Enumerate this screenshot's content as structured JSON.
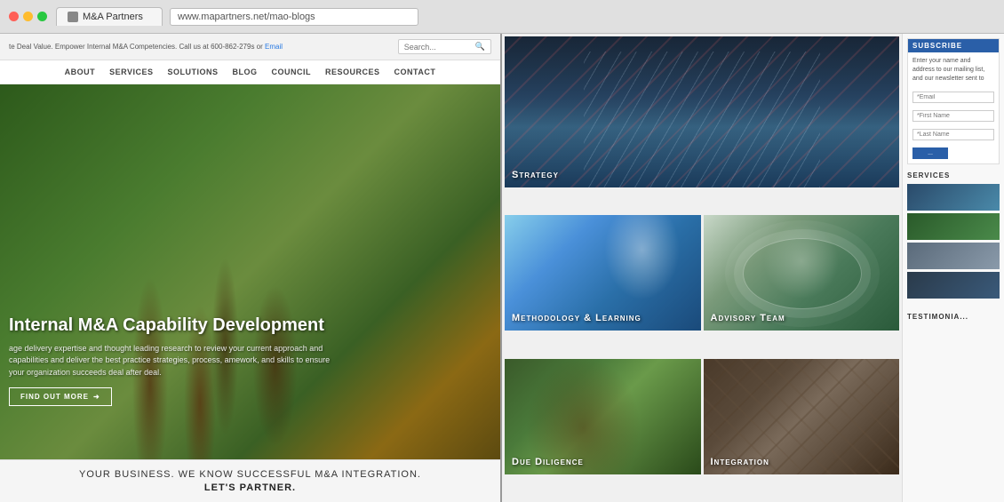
{
  "browser": {
    "tab_title": "M&A Partners",
    "url": "www.mapartners.net/mao-blogs",
    "traffic_lights": [
      "red",
      "yellow",
      "green"
    ]
  },
  "left_site": {
    "top_bar_text": "te Deal Value. Empower Internal M&A Competencies. Call us at 600-862-279s or",
    "top_bar_link": "Email",
    "search_placeholder": "Search...",
    "nav_items": [
      "ABOUT",
      "SERVICES",
      "SOLUTIONS",
      "BLOG",
      "COUNCIL",
      "RESOURCES",
      "CONTACT"
    ],
    "hero_title": "Internal M&A Capability Development",
    "hero_desc": "age delivery expertise and thought leading research to review your current approach and capabilities and deliver the best practice strategies, process, amework, and skills to ensure your organization succeeds deal after deal.",
    "hero_btn": "FIND OUT MORE",
    "tagline_top": "YOUR BUSINESS. WE KNOW SUCCESSFUL M&A INTEGRATION.",
    "tagline_bottom": "LET'S PARTNER."
  },
  "tiles": [
    {
      "id": "strategy",
      "label": "Strategy",
      "type": "wide"
    },
    {
      "id": "methodology",
      "label": "Methodology & Learning",
      "type": "half"
    },
    {
      "id": "advisory",
      "label": "Advisory Team",
      "type": "half"
    },
    {
      "id": "due-diligence",
      "label": "Due Diligence",
      "type": "half"
    },
    {
      "id": "integration",
      "label": "Integration",
      "type": "half"
    }
  ],
  "subscribe": {
    "title": "SUBSCRIBE",
    "desc": "Enter your name and address to our mailing list, and our newsletter sent to",
    "email_placeholder": "*Email",
    "first_name_placeholder": "*First Name",
    "last_name_placeholder": "*Last Name",
    "btn_label": "..."
  },
  "services": {
    "title": "SERVICES",
    "thumbs": [
      "thumb1",
      "thumb2",
      "thumb3",
      "thumb4"
    ]
  },
  "testimonials": {
    "title": "TESTIMONIA..."
  }
}
